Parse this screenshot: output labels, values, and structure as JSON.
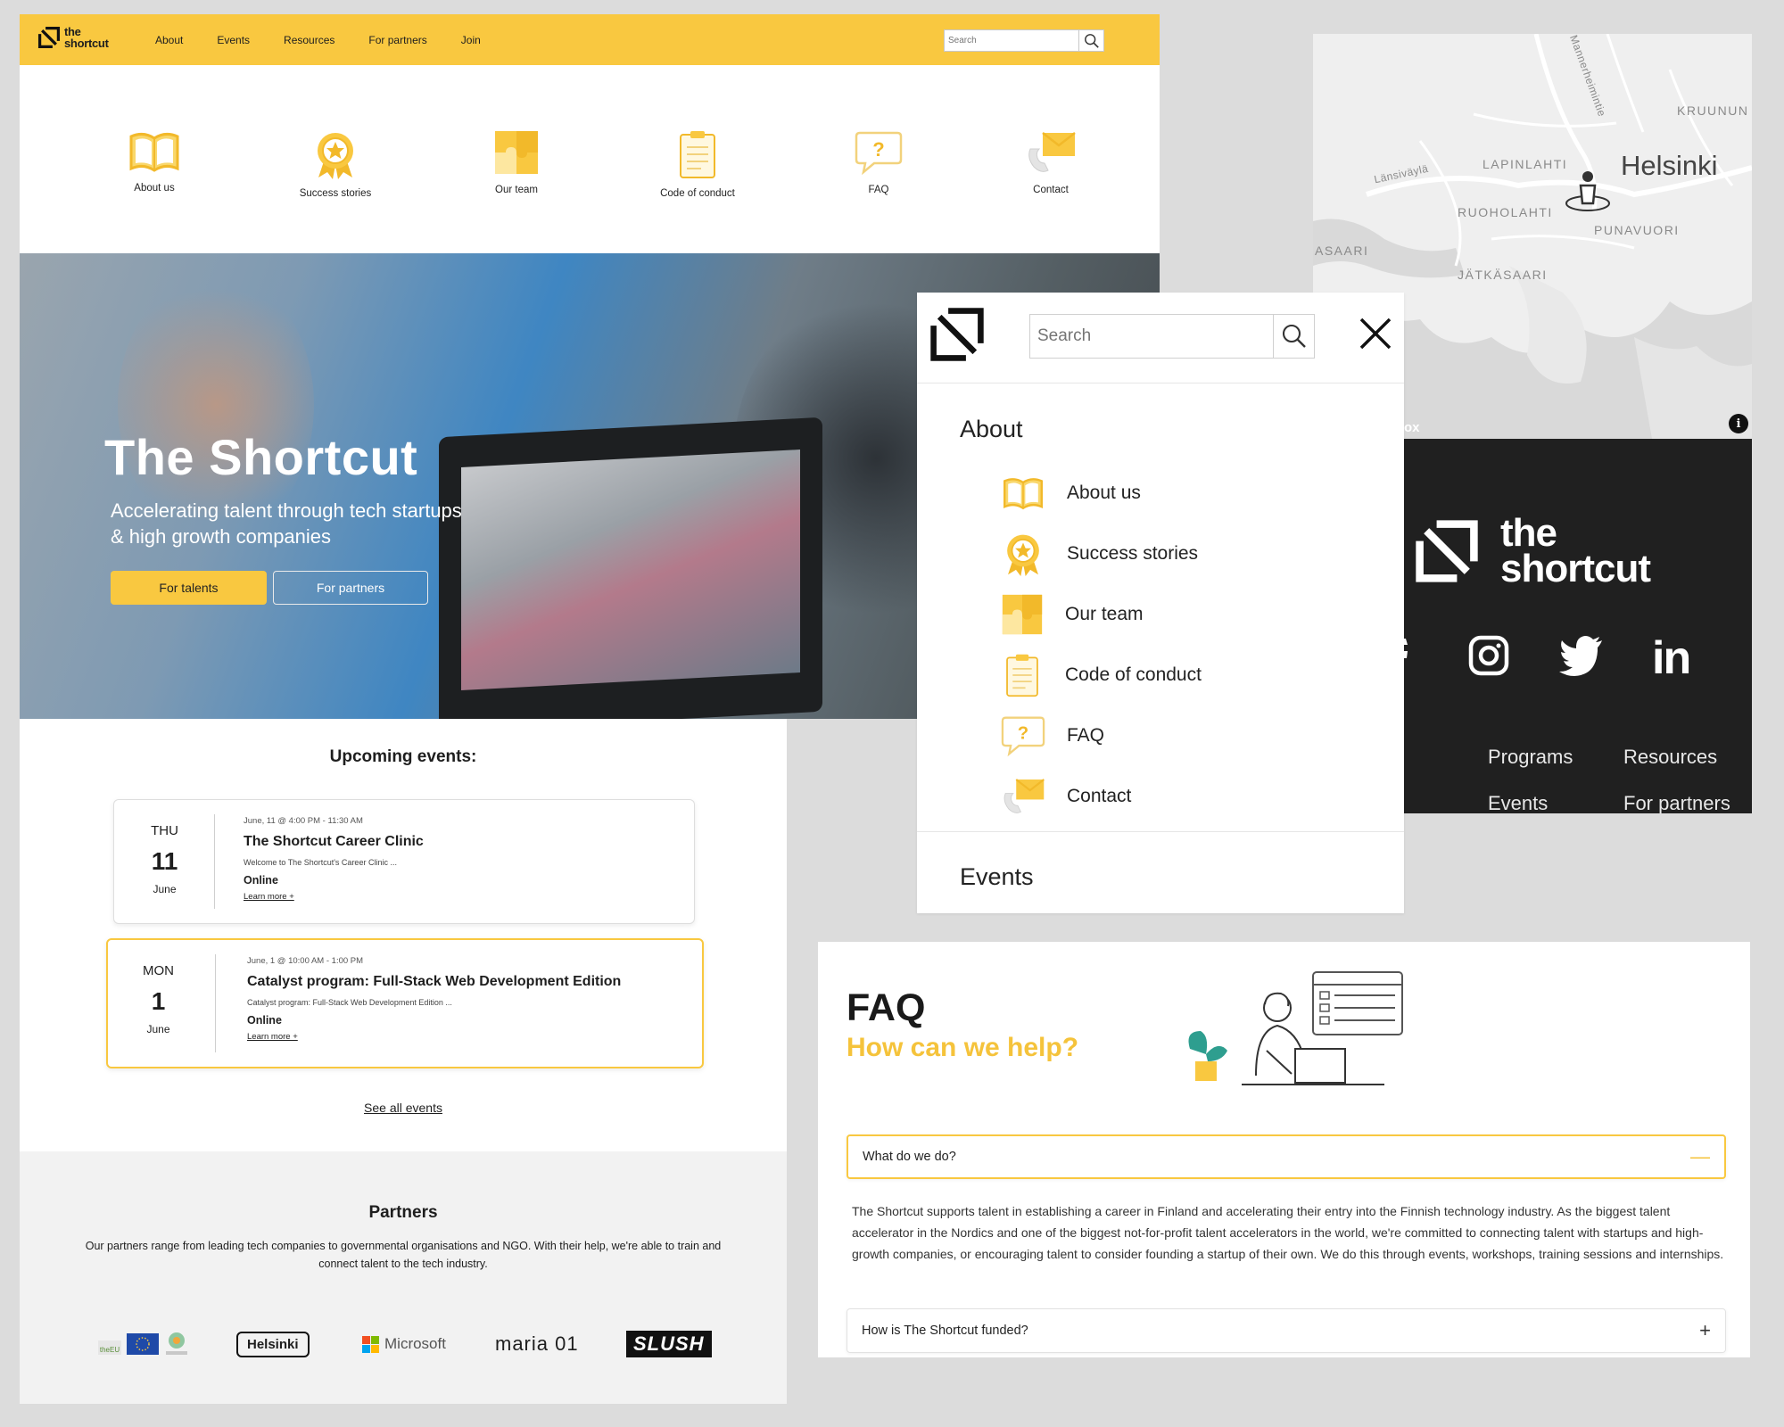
{
  "site": {
    "logo_text_line1": "the",
    "logo_text_line2": "shortcut",
    "nav": [
      "About",
      "Events",
      "Resources",
      "For partners",
      "Join"
    ],
    "search_placeholder": "Search",
    "about_icons": [
      {
        "label": "About us",
        "icon": "book-icon"
      },
      {
        "label": "Success stories",
        "icon": "award-badge-icon"
      },
      {
        "label": "Our team",
        "icon": "puzzle-icon"
      },
      {
        "label": "Code of conduct",
        "icon": "clipboard-icon"
      },
      {
        "label": "FAQ",
        "icon": "question-bubble-icon"
      },
      {
        "label": "Contact",
        "icon": "envelope-phone-icon"
      }
    ],
    "hero": {
      "title": "The Shortcut",
      "tagline_line1": "Accelerating talent through tech startups",
      "tagline_line2": "& high growth companies",
      "cta_primary": "For talents",
      "cta_secondary": "For partners"
    },
    "events": {
      "heading": "Upcoming events:",
      "items": [
        {
          "dow": "THU",
          "day": "11",
          "month": "June",
          "when": "June, 11 @ 4:00 PM - 11:30 AM",
          "title": "The Shortcut Career Clinic",
          "desc": "Welcome to The Shortcut's Career Clinic ...",
          "where": "Online",
          "more": "Learn more +"
        },
        {
          "dow": "MON",
          "day": "1",
          "month": "June",
          "when": "June, 1 @ 10:00 AM - 1:00 PM",
          "title": "Catalyst program: Full-Stack Web Development Edition",
          "desc": "Catalyst program: Full-Stack Web Development Edition ...",
          "where": "Online",
          "more": "Learn more +"
        }
      ],
      "see_all": "See all events"
    },
    "partners": {
      "heading": "Partners",
      "text": "Our partners range from leading tech companies to governmental organisations and NGO. With their help, we're able to train and connect talent to the tech industry.",
      "logos": [
        "theEU",
        "Helsinki",
        "Microsoft",
        "maria 01",
        "SLUSH"
      ]
    }
  },
  "map": {
    "city": "Helsinki",
    "districts": [
      "KRUUNUN",
      "LAPINLAHTI",
      "RUOHOLAHTI",
      "PUNAVUORI",
      "ASAARI",
      "JÄTKÄSAARI"
    ],
    "roads": [
      "Länsiväylä",
      "Mannerheimintie"
    ],
    "attribution": "ox",
    "info_icon": "info-icon"
  },
  "dark_footer": {
    "logo_line1": "the",
    "logo_line2": "shortcut",
    "social": [
      "facebook-icon",
      "instagram-icon",
      "twitter-icon",
      "linkedin-icon"
    ],
    "links": [
      "Programs",
      "Resources",
      "Events",
      "For partners"
    ]
  },
  "menu": {
    "search_placeholder": "Search",
    "section_about": "About",
    "items": [
      "About us",
      "Success stories",
      "Our team",
      "Code of conduct",
      "FAQ",
      "Contact"
    ],
    "section_events": "Events"
  },
  "faq": {
    "title": "FAQ",
    "subtitle": "How can we help?",
    "q1": "What do we do?",
    "a1": "The Shortcut supports talent in establishing a career in Finland and accelerating their entry into the Finnish technology industry. As the biggest talent accelerator in the Nordics and one of the biggest not-for-profit talent accelerators in the world, we're committed to connecting talent with startups and high-growth companies, or encouraging talent to consider founding a startup of their own. We do this through events, workshops, training sessions and internships.",
    "q2": "How is The Shortcut funded?",
    "open_sign": "—",
    "closed_sign": "+"
  },
  "colors": {
    "brand_yellow": "#f9c840",
    "dark": "#202020"
  }
}
